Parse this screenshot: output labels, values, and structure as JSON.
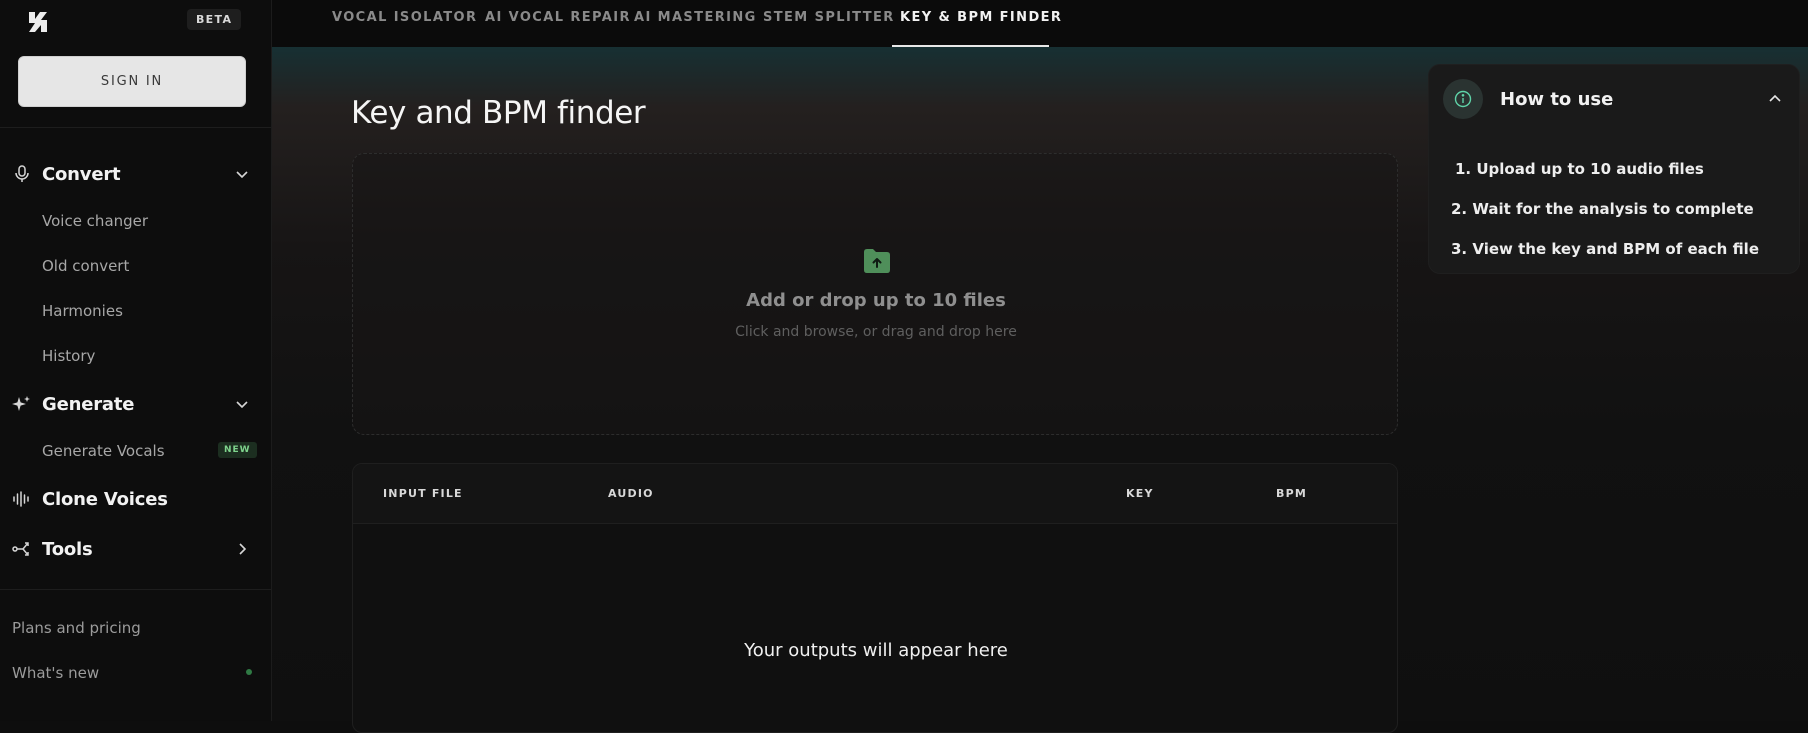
{
  "sidebar": {
    "beta_label": "BETA",
    "sign_in_label": "SIGN IN",
    "sections": {
      "convert": {
        "label": "Convert",
        "items": [
          "Voice changer",
          "Old convert",
          "Harmonies",
          "History"
        ]
      },
      "generate": {
        "label": "Generate",
        "items": [
          "Generate Vocals"
        ],
        "badge": "NEW"
      },
      "clone": {
        "label": "Clone Voices"
      },
      "tools": {
        "label": "Tools"
      }
    },
    "footer": [
      "Plans and pricing",
      "What's new"
    ]
  },
  "topnav": {
    "tabs": [
      "VOCAL ISOLATOR",
      "AI VOCAL REPAIR",
      "AI MASTERING",
      "STEM SPLITTER",
      "KEY & BPM FINDER"
    ],
    "active_tab": "KEY & BPM FINDER"
  },
  "main": {
    "title": "Key and BPM finder",
    "dropzone": {
      "title": "Add or drop up to 10 files",
      "subtitle": "Click and browse, or drag and drop here"
    },
    "table": {
      "columns": [
        "INPUT FILE",
        "AUDIO",
        "KEY",
        "BPM"
      ],
      "empty_message": "Your outputs will appear here"
    }
  },
  "howto": {
    "title": "How to use",
    "steps": [
      "1. Upload up to 10 audio files",
      "2. Wait for the analysis to complete",
      "3. View the key and BPM of each file"
    ]
  },
  "colors": {
    "accent_green": "#4f8f5a",
    "teal_icon": "#5fd3a8",
    "new_badge": "#7ed38c"
  },
  "icons": {
    "logo": "brand-logo-icon",
    "convert": "microphone-icon",
    "generate": "sparkle-icon",
    "clone": "waveform-icon",
    "tools": "branch-icon",
    "upload": "folder-upload-icon",
    "info": "info-icon"
  }
}
